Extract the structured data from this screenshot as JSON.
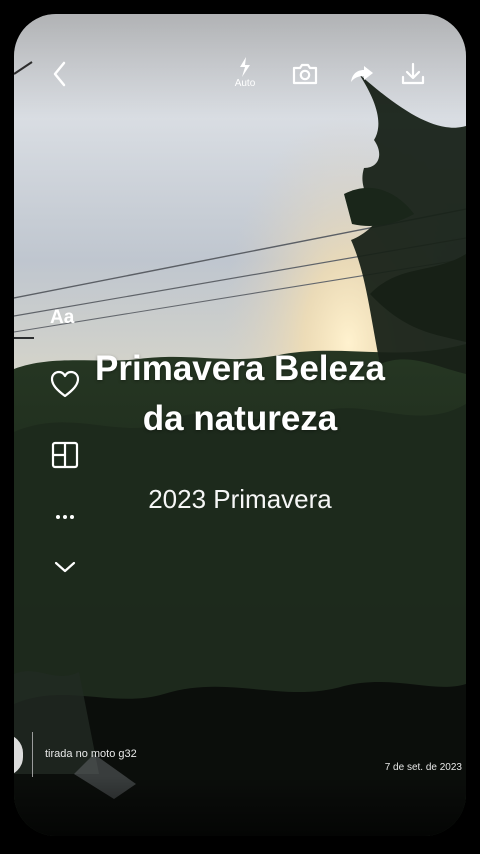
{
  "toolbar": {
    "flash_label": "Auto"
  },
  "editor": {
    "text_tool_label": "Aa"
  },
  "caption": {
    "title_line1": "Primavera Beleza",
    "title_line2": "da natureza",
    "subtitle": "2023 Primavera"
  },
  "footer": {
    "device_note": "tirada no moto g32",
    "date": "7 de set. de 2023"
  },
  "icons": {
    "back": "chevron-left-icon",
    "flash": "flash-icon",
    "camera": "camera-icon",
    "share": "share-icon",
    "download": "download-icon",
    "heart": "heart-icon",
    "layout": "layout-icon",
    "more": "more-icon",
    "collapse": "chevron-down-icon"
  },
  "colors": {
    "text": "#ffffff"
  }
}
